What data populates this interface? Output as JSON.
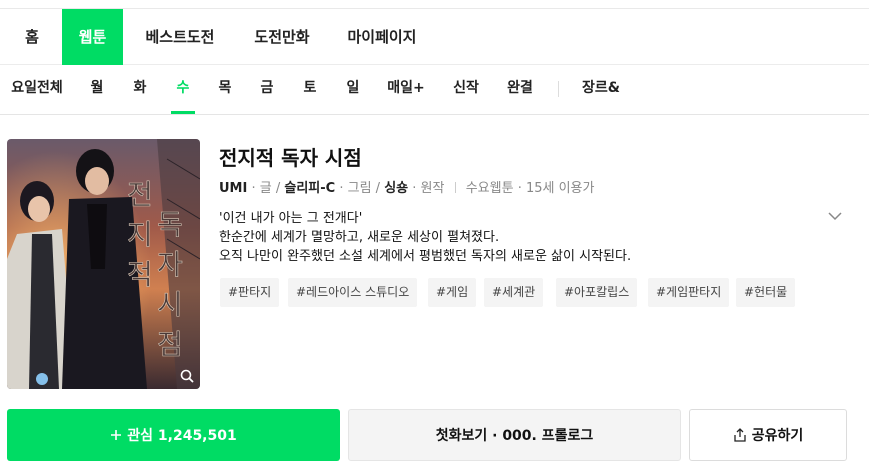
{
  "top_nav": [
    {
      "label": "홈",
      "active": false
    },
    {
      "label": "웹툰",
      "active": true
    },
    {
      "label": "베스트도전",
      "active": false
    },
    {
      "label": "도전만화",
      "active": false
    },
    {
      "label": "마이페이지",
      "active": false
    }
  ],
  "day_tabs": [
    {
      "label": "요일전체",
      "active": false
    },
    {
      "label": "월",
      "active": false
    },
    {
      "label": "화",
      "active": false
    },
    {
      "label": "수",
      "active": true
    },
    {
      "label": "목",
      "active": false
    },
    {
      "label": "금",
      "active": false
    },
    {
      "label": "토",
      "active": false
    },
    {
      "label": "일",
      "active": false
    },
    {
      "label": "매일+",
      "active": false
    },
    {
      "label": "신작",
      "active": false
    },
    {
      "label": "완결",
      "active": false
    },
    {
      "label": "장르&",
      "active": false
    }
  ],
  "thumbnail": {
    "title_text": "전지적 독자 시점"
  },
  "comic": {
    "title": "전지적 독자 시점",
    "writer": "UMI",
    "writer_role": "· 글 /",
    "artist": "슬리피-C",
    "artist_role": "· 그림 /",
    "original": "싱숑",
    "original_role": "· 원작",
    "schedule_age": "수요웹툰 · 15세 이용가",
    "description": [
      "'이건 내가 아는 그 전개다'",
      "한순간에 세계가 멸망하고, 새로운 세상이 펼쳐졌다.",
      "오직 나만이 완주했던 소설 세계에서 평범했던 독자의 새로운 삶이 시작된다."
    ],
    "tags": [
      "#판타지",
      "#레드아이스 스튜디오",
      "#게임",
      "#세계관",
      "#아포칼립스",
      "#게임판타지",
      "#헌터물"
    ]
  },
  "buttons": {
    "favorite_label": "관심 1,245,501",
    "first_episode_label": "첫화보기 · 000. 프롤로그",
    "share_label": "공유하기"
  },
  "colors": {
    "accent": "#00dc64"
  }
}
